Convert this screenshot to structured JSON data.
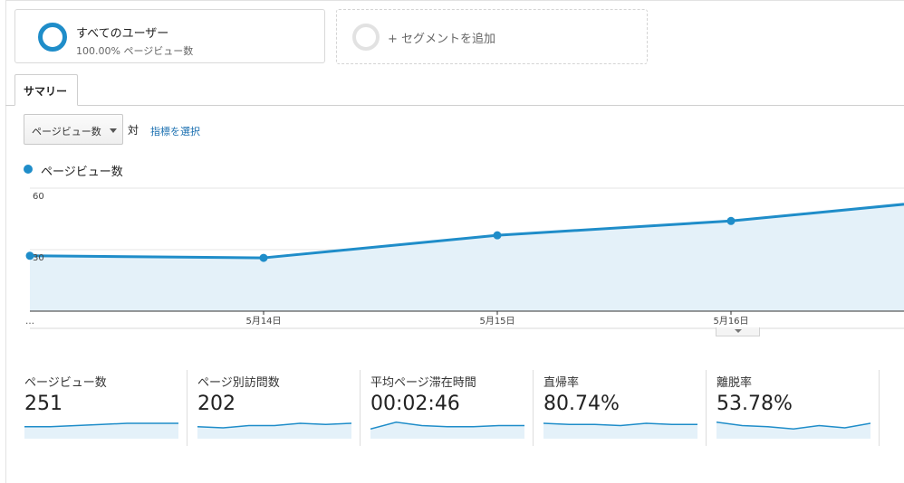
{
  "segments": {
    "all_users": {
      "name": "すべてのユーザー",
      "detail": "100.00% ページビュー数"
    },
    "add_label": "+ セグメントを追加"
  },
  "tabs": [
    {
      "label": "サマリー"
    }
  ],
  "controls": {
    "metric_select": "ページビュー数",
    "versus": "対",
    "select_metric_link": "指標を選択"
  },
  "colors": {
    "accent": "#1f8dc9",
    "area_fill": "#e4f1f9",
    "link": "#1a6fb0"
  },
  "chart_data": {
    "type": "area",
    "series": [
      {
        "name": "ページビュー数",
        "values": [
          27,
          26,
          37,
          44,
          55
        ]
      }
    ],
    "x": [
      "…",
      "5月14日",
      "5月15日",
      "5月16日",
      ""
    ],
    "y_ticks": [
      {
        "label": "60",
        "value": 60
      },
      {
        "label": "30",
        "value": 30
      }
    ],
    "ylim": [
      0,
      60
    ],
    "grid": true,
    "legend": "top-left"
  },
  "scorecards": [
    {
      "label": "ページビュー数",
      "value": "251",
      "spark": [
        9,
        9,
        10,
        11,
        12,
        12,
        12
      ]
    },
    {
      "label": "ページ別訪問数",
      "value": "202",
      "spark": [
        9,
        8,
        10,
        10,
        12,
        11,
        12
      ]
    },
    {
      "label": "平均ページ滞在時間",
      "value": "00:02:46",
      "spark": [
        7,
        13,
        10,
        9,
        9,
        10,
        10
      ]
    },
    {
      "label": "直帰率",
      "value": "80.74%",
      "spark": [
        12,
        11,
        11,
        10,
        12,
        11,
        11
      ]
    },
    {
      "label": "離脱率",
      "value": "53.78%",
      "spark": [
        13,
        10,
        9,
        7,
        10,
        8,
        12
      ]
    }
  ]
}
